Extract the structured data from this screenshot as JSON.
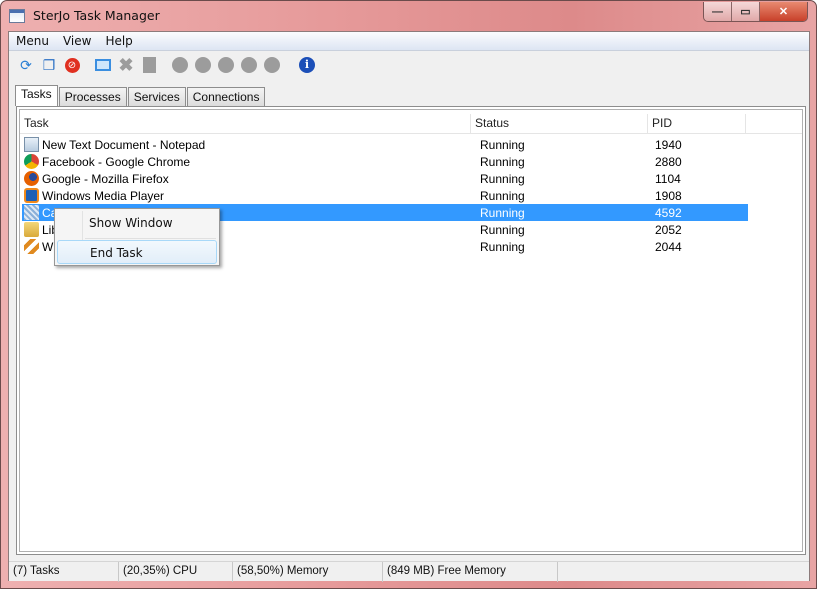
{
  "window": {
    "title": "SterJo Task Manager",
    "minimize": "—",
    "maximize": "▭",
    "close": "✕"
  },
  "menu": [
    "Menu",
    "View",
    "Help"
  ],
  "tabs": [
    "Tasks",
    "Processes",
    "Services",
    "Connections"
  ],
  "columns": [
    "Task",
    "Status",
    "PID"
  ],
  "rows": [
    {
      "task": "New Text Document - Notepad",
      "status": "Running",
      "pid": "1940",
      "icon": "notepad-icon"
    },
    {
      "task": "Facebook - Google Chrome",
      "status": "Running",
      "pid": "2880",
      "icon": "chrome-icon"
    },
    {
      "task": "Google - Mozilla Firefox",
      "status": "Running",
      "pid": "1104",
      "icon": "firefox-icon"
    },
    {
      "task": "Windows Media Player",
      "status": "Running",
      "pid": "1908",
      "icon": "media-player-icon"
    },
    {
      "task": "Cal",
      "status": "Running",
      "pid": "4592",
      "icon": "calculator-icon"
    },
    {
      "task": "Lib",
      "status": "Running",
      "pid": "2052",
      "icon": "folder-icon"
    },
    {
      "task": "Wi",
      "status": "Running",
      "pid": "2044",
      "icon": "app-icon"
    }
  ],
  "context_menu": [
    "Show Window",
    "End Task"
  ],
  "statusbar": {
    "tasks": "(7) Tasks",
    "cpu": "(20,35%) CPU",
    "memory": "(58,50%) Memory",
    "free": "(849 MB) Free Memory"
  },
  "colors": {
    "selection": "#3399ff",
    "frame": "#e69a9a"
  }
}
